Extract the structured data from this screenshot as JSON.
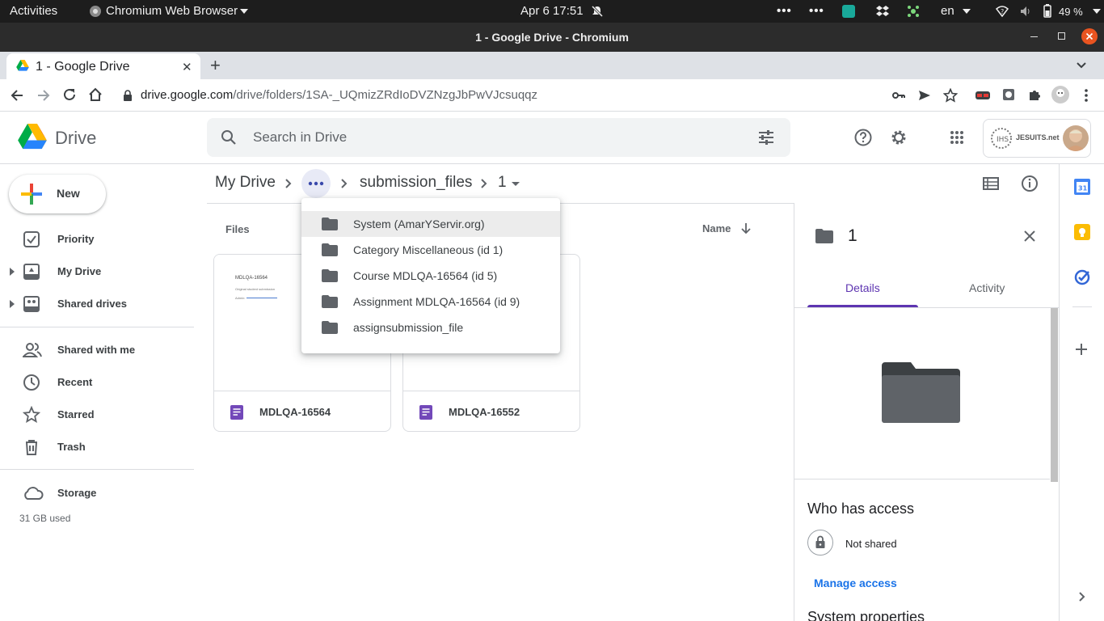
{
  "system_bar": {
    "activities": "Activities",
    "app_name": "Chromium Web Browser",
    "clock": "Apr 6  17:51",
    "lang": "en",
    "battery": "49 %"
  },
  "window": {
    "title": "1 - Google Drive - Chromium"
  },
  "tab": {
    "title": "1 - Google Drive"
  },
  "address": {
    "host": "drive.google.com",
    "path": "/drive/folders/1SA-_UQmizZRdIoDVZNzgJbPwVJcsuqqz"
  },
  "drive": {
    "logo_text": "Drive",
    "search_placeholder": "Search in Drive",
    "account_text": "JESUITS.net",
    "new_label": "New"
  },
  "sidebar": {
    "items": [
      {
        "label": "Priority",
        "icon": "checkbox-icon"
      },
      {
        "label": "My Drive",
        "icon": "my-drive-icon"
      },
      {
        "label": "Shared drives",
        "icon": "shared-drives-icon"
      },
      {
        "label": "Shared with me",
        "icon": "people-icon"
      },
      {
        "label": "Recent",
        "icon": "clock-icon"
      },
      {
        "label": "Starred",
        "icon": "star-icon"
      },
      {
        "label": "Trash",
        "icon": "trash-icon"
      }
    ],
    "storage_label": "Storage",
    "storage_used": "31 GB used"
  },
  "breadcrumb": {
    "root": "My Drive",
    "folder": "submission_files",
    "current": "1"
  },
  "files": {
    "section_label": "Files",
    "sort_label": "Name",
    "items": [
      {
        "name": "MDLQA-16564",
        "thumb_title": "MDLQA-16564",
        "thumb_line1": "Original student submission",
        "thumb_line2": "Admin:"
      },
      {
        "name": "MDLQA-16552"
      }
    ]
  },
  "path_menu": {
    "items": [
      "System (AmarYServir.org)",
      "Category Miscellaneous (id 1)",
      "Course MDLQA-16564 (id 5)",
      "Assignment MDLQA-16564 (id 9)",
      "assignsubmission_file"
    ]
  },
  "details": {
    "title": "1",
    "tab_details": "Details",
    "tab_activity": "Activity",
    "who_has_access": "Who has access",
    "not_shared": "Not shared",
    "manage_access": "Manage access",
    "system_properties": "System properties"
  },
  "colors": {
    "accent": "#1a73e8",
    "active_tab": "#5e35b1",
    "docs_purple": "#7248b9"
  }
}
